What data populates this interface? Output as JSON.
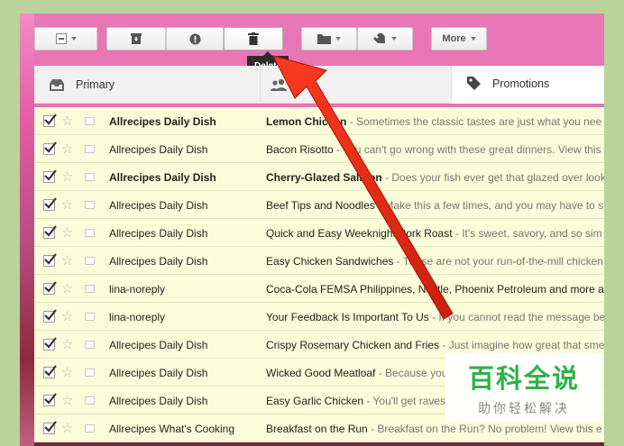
{
  "toolbar": {
    "more_label": "More",
    "tooltip": "Delete"
  },
  "tabs": {
    "primary": "Primary",
    "promotions": "Promotions"
  },
  "emails": [
    {
      "sender": "Allrecipes Daily Dish",
      "subject": "Lemon Chicken",
      "snippet": " - Sometimes the classic tastes are just what you nee",
      "unread": true
    },
    {
      "sender": "Allrecipes Daily Dish",
      "subject": "Bacon Risotto",
      "snippet": " - You can't go wrong with these great dinners. View this ema",
      "unread": false
    },
    {
      "sender": "Allrecipes Daily Dish",
      "subject": "Cherry-Glazed Salmon",
      "snippet": " - Does your fish ever get that glazed over look",
      "unread": true
    },
    {
      "sender": "Allrecipes Daily Dish",
      "subject": "Beef Tips and Noodles",
      "snippet": " - Make this a few times, and you may have to s",
      "unread": false
    },
    {
      "sender": "Allrecipes Daily Dish",
      "subject": "Quick and Easy Weeknight Pork Roast",
      "snippet": " - It's sweet, savory, and so sim",
      "unread": false
    },
    {
      "sender": "Allrecipes Daily Dish",
      "subject": "Easy Chicken Sandwiches",
      "snippet": " - These are not your run-of-the-mill chicken",
      "unread": false
    },
    {
      "sender": "lina-noreply",
      "subject": "Coca-Cola FEMSA Philippines, Nestle, Phoenix Petroleum and more a",
      "snippet": "",
      "unread": false
    },
    {
      "sender": "lina-noreply",
      "subject": "Your Feedback Is Important To Us",
      "snippet": " - If you cannot read the message be",
      "unread": false
    },
    {
      "sender": "Allrecipes Daily Dish",
      "subject": "Crispy Rosemary Chicken and Fries",
      "snippet": " - Just imagine how great that smell",
      "unread": false
    },
    {
      "sender": "Allrecipes Daily Dish",
      "subject": "Wicked Good Meatloaf",
      "snippet": " - Because you",
      "unread": false
    },
    {
      "sender": "Allrecipes Daily Dish",
      "subject": "Easy Garlic Chicken",
      "snippet": " - You'll get raves",
      "unread": false
    },
    {
      "sender": "Allrecipes What's Cooking",
      "subject": "Breakfast on the Run",
      "snippet": " - Breakfast on the Run? No problem! View this e",
      "unread": false
    }
  ],
  "watermark": {
    "title": "百科全说",
    "subtitle": "助你轻松解决"
  },
  "colors": {
    "row_bg": "#fbfcd9",
    "arrow": "#e02d1a",
    "watermark_green": "#2db24a"
  }
}
